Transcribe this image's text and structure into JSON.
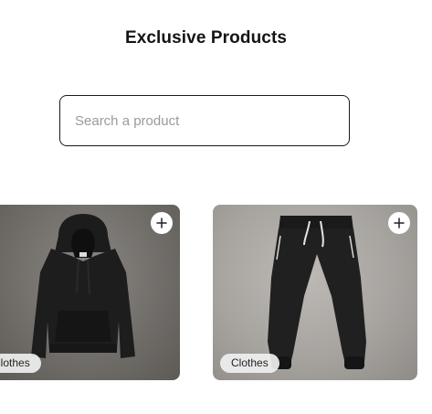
{
  "header": {
    "title": "Exclusive Products"
  },
  "search": {
    "placeholder": "Search a product",
    "value": ""
  },
  "products": [
    {
      "category": "Clothes",
      "item": "hoodie",
      "icon": "plus-icon"
    },
    {
      "category": "Clothes",
      "item": "sweatpants",
      "icon": "plus-icon"
    }
  ],
  "colors": {
    "text": "#141414",
    "border": "#1a1a1a",
    "placeholder": "#9a9a9a",
    "tag_bg": "#f0f0f0"
  }
}
